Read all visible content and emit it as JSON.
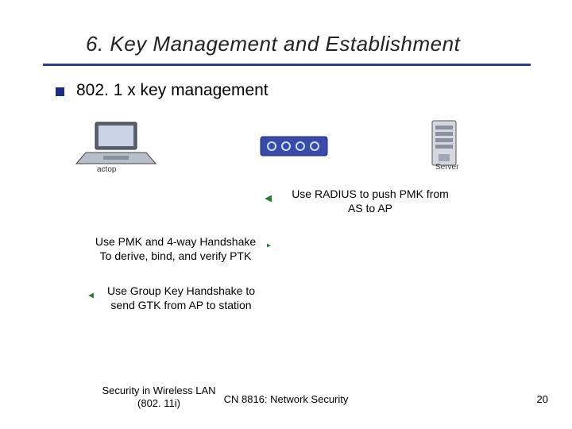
{
  "title": "6. Key Management and Establishment",
  "subhead": "802. 1 x key management",
  "device_labels": {
    "laptop": "actop",
    "server": "Server"
  },
  "boxes": {
    "radius_line1": "Use RADIUS to push PMK from",
    "radius_line2": "AS to AP",
    "pmk_line1": "Use PMK and 4-way Handshake",
    "pmk_line2": "To derive, bind, and verify PTK",
    "gtk_line1": "Use Group Key Handshake to",
    "gtk_line2": "send GTK from AP to station"
  },
  "footer": {
    "left_line1": "Security in Wireless LAN",
    "left_line2": "(802. 11i)",
    "center": "CN 8816: Network Security",
    "page": "20"
  },
  "colors": {
    "rule": "#2b3a93",
    "arrow_red": "#c62828",
    "arrow_green": "#2e7d32"
  }
}
